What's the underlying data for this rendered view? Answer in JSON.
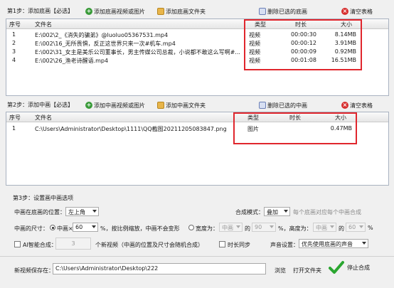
{
  "step1": {
    "label": "第1步：添加底画【必选】",
    "add_video_label": "添加底画视频或图片",
    "add_folder_label": "添加底画文件夹",
    "delete_selected_label": "删除已选的底画",
    "clear_label": "清空表格",
    "columns": [
      "序号",
      "文件名",
      "类型",
      "时长",
      "大小"
    ],
    "rows": [
      {
        "no": "1",
        "name": "E:\\002\\2_《消失的骗弟》@luoluo05367531.mp4",
        "type": "视频",
        "duration": "00:00:30",
        "size": "8.14MB"
      },
      {
        "no": "2",
        "name": "E:\\002\\16_无所畏惧，反正这世界只来一次#机车.mp4",
        "type": "视频",
        "duration": "00:00:12",
        "size": "3.91MB"
      },
      {
        "no": "3",
        "name": "E:\\002\\31_女主是美乐公司董事长，男主传媒公司总裁，小说都不敢这么写啊#...",
        "type": "视频",
        "duration": "00:00:09",
        "size": "0.92MB"
      },
      {
        "no": "4",
        "name": "E:\\002\\26_渔老诗醒语.mp4",
        "type": "视频",
        "duration": "00:01:08",
        "size": "16.51MB"
      }
    ]
  },
  "step2": {
    "label": "第2步：添加中画【必选】",
    "add_video_label": "添加中画视频或图片",
    "add_folder_label": "添加中画文件夹",
    "delete_selected_label": "删除已选的中画",
    "clear_label": "清空表格",
    "columns": [
      "序号",
      "文件名",
      "类型",
      "时长",
      "大小"
    ],
    "rows": [
      {
        "no": "1",
        "name": "C:\\Users\\Administrator\\Desktop\\1111\\QQ截图20211205083847.png",
        "type": "图片",
        "duration": "",
        "size": "0.47MB"
      }
    ]
  },
  "step3": {
    "label": "第3步：设置画中画选项",
    "position_label": "中画在底画的位置：",
    "position_value": "左上角",
    "mode_label": "合成模式：",
    "mode_value": "叠加",
    "mode_hint": "每个底画对应每个中画合成",
    "size_label": "中画的尺寸：",
    "size_option1_prefix": "中画×",
    "size_option1_value": "60",
    "size_option1_suffix": "%，按比例缩放，中画不会变形",
    "width_label": "宽度为：",
    "width_from": "中画",
    "of1": "的",
    "width_pct": "90",
    "height_label": "%，高度为：",
    "height_from": "中画",
    "of2": "的",
    "height_pct": "60",
    "pct": "%",
    "ai_label": "AI智能合成：",
    "ai_count": "3",
    "ai_suffix": "个新视频（中画的位置及尺寸会随机合成）",
    "sync_label": "时长同步",
    "sound_label": "声音设置：",
    "sound_value": "优先使用底画的声音"
  },
  "save": {
    "label": "新视频保存在：",
    "path": "C:\\Users\\Administrator\\Desktop\\222",
    "browse_label": "浏览",
    "open_folder_label": "打开文件夹",
    "stop_label": "停止合成"
  },
  "colors": {
    "highlight": "#e0262d",
    "accent": "#2aa630"
  }
}
